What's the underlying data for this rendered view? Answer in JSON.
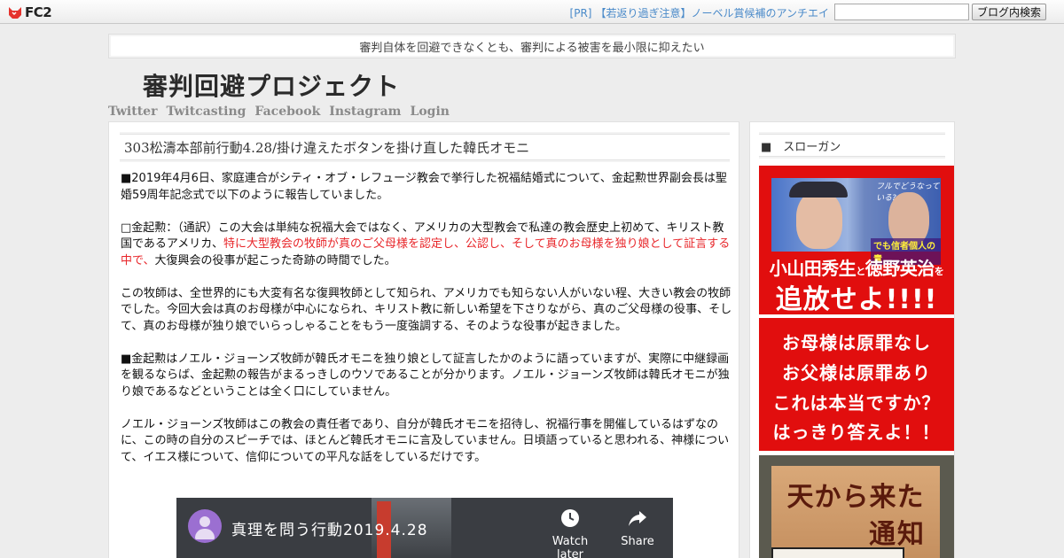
{
  "topbar": {
    "logo_text": "FC2",
    "pr_tag": "[PR]",
    "pr_text": "【若返り過ぎ注意】ノーベル賞候補のアンチエイ",
    "search_value": "",
    "search_button": "ブログ内検索"
  },
  "blog": {
    "tagline": "審判自体を回避できなくとも、審判による被害を最小限に抑えたい",
    "title": "審判回避プロジェクト",
    "nav": [
      "Twitter",
      "Twitcasting",
      "Facebook",
      "Instagram",
      "Login"
    ]
  },
  "entry": {
    "title": "303松濤本部前行動4.28/掛け違えたボタンを掛け直した韓氏オモニ",
    "p1": "■2019年4月6日、家庭連合がシティ・オブ・レフュージ教会で挙行した祝福結婚式について、金起勲世界副会長は聖婚59周年記念式で以下のように報告していました。",
    "p2_before": "□金起勲：（通訳）この大会は単純な祝福大会ではなく、アメリカの大型教会で私達の教会歴史上初めて、キリスト教国であるアメリカ、",
    "p2_red": "特に大型教会の牧師が真のご父母様を認定し、公認し、そして真のお母様を独り娘として証言する中で、",
    "p2_after": "大復興会の役事が起こった奇跡の時間でした。",
    "p3": "この牧師は、全世界的にも大変有名な復興牧師として知られ、アメリカでも知らない人がいない程、大きい教会の牧師でした。今回大会は真のお母様が中心になられ、キリスト教に新しい希望を下さりながら、真のご父母様の役事、そして、真のお母様が独り娘でいらっしゃることをもう一度強調する、そのような役事が起きました。",
    "p4": "■金起勲はノエル・ジョーンズ牧師が韓氏オモニを独り娘として証言したかのように語っていますが、実際に中継録画を観るならば、金起勲の報告がまるっきしのウソであることが分かります。ノエル・ジョーンズ牧師は韓氏オモニが独り娘であるなどということは全く口にしていません。",
    "p5": "ノエル・ジョーンズ牧師はこの教会の責任者であり、自分が韓氏オモニを招待し、祝福行事を開催しているはずなのに、この時の自分のスピーチでは、ほとんど韓氏オモニに言及していません。日頃語っていると思われる、神様について、イエス様について、信仰についての平凡な話をしているだけです。"
  },
  "video": {
    "title": "真理を問う行動2019.4.28",
    "watch_later": "Watch later",
    "share": "Share"
  },
  "sidebar": {
    "heading": "■　スローガン",
    "banner1": {
      "tag_top": "フルでどうなっている?",
      "tag_bottom": "でも信者個人の責",
      "name1": "小山田秀生",
      "conj": "と",
      "name2": "徳野英治",
      "particle": "を",
      "order": "追放せよ!!!!"
    },
    "banner2": {
      "line1": "お母様は原罪なし",
      "line2": "お父様は原罪あり",
      "line3": "これは本当ですか？",
      "line4": "はっきり答えよ！！"
    },
    "banner3": {
      "line1": "天から来た",
      "line2": "通知"
    }
  },
  "colors": {
    "accent_red": "#e8262a",
    "link_blue": "#4a8ac9",
    "banner_red": "#e10e0e"
  }
}
